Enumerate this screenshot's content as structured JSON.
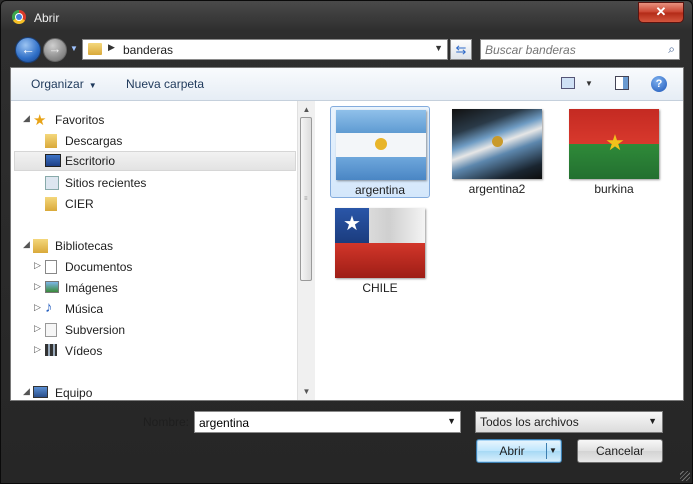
{
  "window": {
    "title": "Abrir",
    "close_label": "✕"
  },
  "address_bar": {
    "path": "banderas"
  },
  "search": {
    "placeholder": "Buscar banderas"
  },
  "command_bar": {
    "organize_label": "Organizar",
    "new_folder_label": "Nueva carpeta"
  },
  "nav": {
    "items": [
      {
        "label": "Favoritos",
        "icon": "star-icon"
      },
      {
        "label": "Descargas",
        "icon": "downloads-folder-icon"
      },
      {
        "label": "Escritorio",
        "icon": "desktop-icon",
        "selected": true
      },
      {
        "label": "Sitios recientes",
        "icon": "recent-places-icon"
      },
      {
        "label": "CIER",
        "icon": "folder-icon"
      },
      {
        "label": "Bibliotecas",
        "icon": "libraries-icon"
      },
      {
        "label": "Documentos",
        "icon": "documents-icon"
      },
      {
        "label": "Imágenes",
        "icon": "pictures-icon"
      },
      {
        "label": "Música",
        "icon": "music-icon"
      },
      {
        "label": "Subversion",
        "icon": "subversion-icon"
      },
      {
        "label": "Vídeos",
        "icon": "videos-icon"
      },
      {
        "label": "Equipo",
        "icon": "computer-icon"
      }
    ]
  },
  "files": [
    {
      "name": "argentina",
      "selected": true
    },
    {
      "name": "argentina2"
    },
    {
      "name": "burkina"
    },
    {
      "name": "CHILE"
    }
  ],
  "footer": {
    "name_label": "Nombre:",
    "filename_value": "argentina",
    "filetype_value": "Todos los archivos",
    "open_label": "Abrir",
    "cancel_label": "Cancelar"
  },
  "colors": {
    "selection": "#d4e7fb",
    "accent": "#3c7fb1",
    "chrome": "#2e2e2e"
  }
}
